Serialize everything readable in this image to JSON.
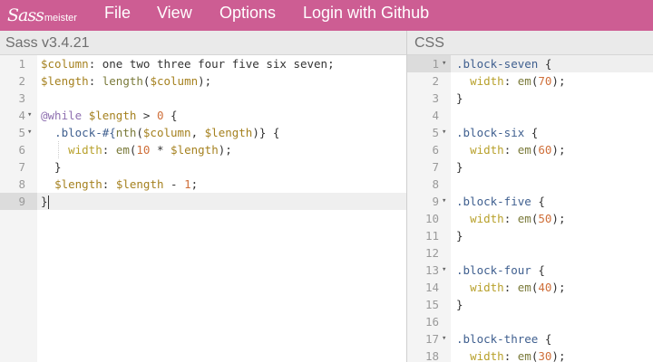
{
  "app": {
    "logo_script": "Sass",
    "logo_small": "meister"
  },
  "menu": {
    "file": "File",
    "view": "View",
    "options": "Options",
    "login": "Login with Github"
  },
  "sass_pane": {
    "title": "Sass v3.4.21",
    "active_line": 9,
    "lines": [
      {
        "n": "1",
        "fold": false,
        "tokens": [
          [
            "var",
            "$column"
          ],
          [
            "text",
            ": one two three four five six seven;"
          ]
        ]
      },
      {
        "n": "2",
        "fold": false,
        "tokens": [
          [
            "var",
            "$length"
          ],
          [
            "text",
            ": "
          ],
          [
            "fn",
            "length"
          ],
          [
            "text",
            "("
          ],
          [
            "var",
            "$column"
          ],
          [
            "text",
            ");"
          ]
        ]
      },
      {
        "n": "3",
        "fold": false,
        "tokens": []
      },
      {
        "n": "4",
        "fold": true,
        "tokens": [
          [
            "kw",
            "@while"
          ],
          [
            "text",
            " "
          ],
          [
            "var",
            "$length"
          ],
          [
            "text",
            " > "
          ],
          [
            "num",
            "0"
          ],
          [
            "text",
            " {"
          ]
        ]
      },
      {
        "n": "5",
        "fold": true,
        "tokens": [
          [
            "text",
            "  "
          ],
          [
            "sel",
            ".block-#{"
          ],
          [
            "fn",
            "nth"
          ],
          [
            "text",
            "("
          ],
          [
            "var",
            "$column"
          ],
          [
            "text",
            ", "
          ],
          [
            "var",
            "$length"
          ],
          [
            "text",
            ")} {"
          ]
        ]
      },
      {
        "n": "6",
        "fold": false,
        "tokens": [
          [
            "text",
            "    "
          ],
          [
            "prop",
            "width"
          ],
          [
            "text",
            ": "
          ],
          [
            "fn",
            "em"
          ],
          [
            "text",
            "("
          ],
          [
            "num",
            "10"
          ],
          [
            "text",
            " * "
          ],
          [
            "var",
            "$length"
          ],
          [
            "text",
            ");"
          ]
        ]
      },
      {
        "n": "7",
        "fold": false,
        "tokens": [
          [
            "text",
            "  }"
          ]
        ]
      },
      {
        "n": "8",
        "fold": false,
        "tokens": [
          [
            "text",
            "  "
          ],
          [
            "var",
            "$length"
          ],
          [
            "text",
            ": "
          ],
          [
            "var",
            "$length"
          ],
          [
            "text",
            " - "
          ],
          [
            "num",
            "1"
          ],
          [
            "text",
            ";"
          ]
        ]
      },
      {
        "n": "9",
        "fold": false,
        "tokens": [
          [
            "text",
            "}"
          ]
        ]
      }
    ]
  },
  "css_pane": {
    "title": "CSS",
    "active_line": 1,
    "lines": [
      {
        "n": "1",
        "fold": true,
        "tokens": [
          [
            "sel",
            ".block-seven"
          ],
          [
            "text",
            " {"
          ]
        ]
      },
      {
        "n": "2",
        "fold": false,
        "tokens": [
          [
            "text",
            "  "
          ],
          [
            "prop",
            "width"
          ],
          [
            "text",
            ": "
          ],
          [
            "fn",
            "em"
          ],
          [
            "text",
            "("
          ],
          [
            "num",
            "70"
          ],
          [
            "text",
            ");"
          ]
        ]
      },
      {
        "n": "3",
        "fold": false,
        "tokens": [
          [
            "text",
            "}"
          ]
        ]
      },
      {
        "n": "4",
        "fold": false,
        "tokens": []
      },
      {
        "n": "5",
        "fold": true,
        "tokens": [
          [
            "sel",
            ".block-six"
          ],
          [
            "text",
            " {"
          ]
        ]
      },
      {
        "n": "6",
        "fold": false,
        "tokens": [
          [
            "text",
            "  "
          ],
          [
            "prop",
            "width"
          ],
          [
            "text",
            ": "
          ],
          [
            "fn",
            "em"
          ],
          [
            "text",
            "("
          ],
          [
            "num",
            "60"
          ],
          [
            "text",
            ");"
          ]
        ]
      },
      {
        "n": "7",
        "fold": false,
        "tokens": [
          [
            "text",
            "}"
          ]
        ]
      },
      {
        "n": "8",
        "fold": false,
        "tokens": []
      },
      {
        "n": "9",
        "fold": true,
        "tokens": [
          [
            "sel",
            ".block-five"
          ],
          [
            "text",
            " {"
          ]
        ]
      },
      {
        "n": "10",
        "fold": false,
        "tokens": [
          [
            "text",
            "  "
          ],
          [
            "prop",
            "width"
          ],
          [
            "text",
            ": "
          ],
          [
            "fn",
            "em"
          ],
          [
            "text",
            "("
          ],
          [
            "num",
            "50"
          ],
          [
            "text",
            ");"
          ]
        ]
      },
      {
        "n": "11",
        "fold": false,
        "tokens": [
          [
            "text",
            "}"
          ]
        ]
      },
      {
        "n": "12",
        "fold": false,
        "tokens": []
      },
      {
        "n": "13",
        "fold": true,
        "tokens": [
          [
            "sel",
            ".block-four"
          ],
          [
            "text",
            " {"
          ]
        ]
      },
      {
        "n": "14",
        "fold": false,
        "tokens": [
          [
            "text",
            "  "
          ],
          [
            "prop",
            "width"
          ],
          [
            "text",
            ": "
          ],
          [
            "fn",
            "em"
          ],
          [
            "text",
            "("
          ],
          [
            "num",
            "40"
          ],
          [
            "text",
            ");"
          ]
        ]
      },
      {
        "n": "15",
        "fold": false,
        "tokens": [
          [
            "text",
            "}"
          ]
        ]
      },
      {
        "n": "16",
        "fold": false,
        "tokens": []
      },
      {
        "n": "17",
        "fold": true,
        "tokens": [
          [
            "sel",
            ".block-three"
          ],
          [
            "text",
            " {"
          ]
        ]
      },
      {
        "n": "18",
        "fold": false,
        "tokens": [
          [
            "text",
            "  "
          ],
          [
            "prop",
            "width"
          ],
          [
            "text",
            ": "
          ],
          [
            "fn",
            "em"
          ],
          [
            "text",
            "("
          ],
          [
            "num",
            "30"
          ],
          [
            "text",
            ");"
          ]
        ]
      }
    ]
  },
  "colors": {
    "topbar": "#cd5d93",
    "header_bg": "#eaeaea",
    "gutter_bg": "#f4f4f4"
  }
}
